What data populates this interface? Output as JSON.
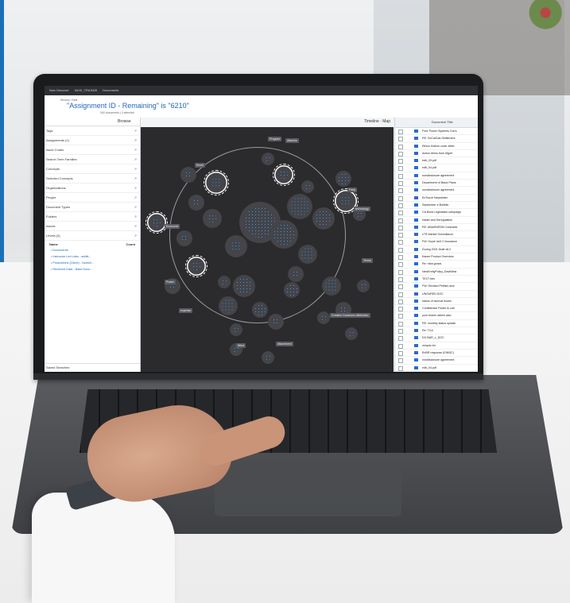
{
  "app": {
    "topbar": [
      "Nuix Discover",
      "NUIX_TRAIN28",
      "Documents"
    ],
    "breadcrumb": "Review / Sets",
    "title": "\"Assignment ID - Remaining\" is \"6210\"",
    "counts": "340 documents  |  0 selected",
    "browse_label": "Browse",
    "timeline_label": "Timeline",
    "map_label": "Map"
  },
  "left_panel": {
    "facets": [
      "Tags",
      "Assignments (1)",
      "Issue Codes",
      "Search Term Families",
      "Concepts",
      "Selected Concepts",
      "Organizations",
      "People",
      "Document Types",
      "Folders",
      "Issues",
      "Levels (4)"
    ],
    "tree_header": {
      "name": "Name",
      "count": "Count"
    },
    "tree_rows": [
      "Documents",
      "Instructor Led Labs - additi...",
      "Productions (Client) - Nonbill...",
      "Received Data - Base Docu..."
    ],
    "saved_searches": "Saved Searches"
  },
  "cluster_labels": [
    "Program",
    "dissolve",
    "Email",
    "Party",
    "technology",
    "Economic",
    "Terms",
    "Power",
    "expense",
    "Creative Commons Attribution",
    "Attachment",
    "Wind"
  ],
  "right_panel": {
    "column_header": "Document Title",
    "documents": [
      "Fwd: Power Systems Corrs",
      "RE: SoCalGas Settlement",
      "Ethics Hotline cover letter",
      "Action Items from Mgmt",
      "edb_03.pdf",
      "edb_04.pdf",
      "nondisclosure agreement",
      "Department of Basic Plans",
      "nondisclosure agreement",
      "EnTouch Newsletter",
      "September e.Bulletin",
      "CA Bond Legislation campaign",
      "Nader and Deregulation",
      "RE: ABA/ENRON Contracts",
      "LTR Market Surveillance",
      "FW: Doyle Unit 2 Insurance",
      "During 2001 Draft v8.2",
      "Kaiser Product Overview",
      "Re: mba grows",
      "NewEnrityPolicy_EastWest",
      "TEXT.htm",
      "FW: Revised Petition and",
      "UNSURED.DOC",
      "status of accrual books",
      "Confidential Folder to call",
      "your broker admin also",
      "RE: monthly status update",
      "Re: TCA",
      "DO BAR_L_DOC",
      "mmpdc.txt",
      "EnBR response (EIMSC)",
      "nondisclosure agreement",
      "edb_04.pdf"
    ]
  },
  "colors": {
    "accent": "#2266bb",
    "cluster_dot": "#3b9cf0",
    "canvas_bg": "#2b2b2e",
    "side_stripe": "#1b6fb5"
  }
}
